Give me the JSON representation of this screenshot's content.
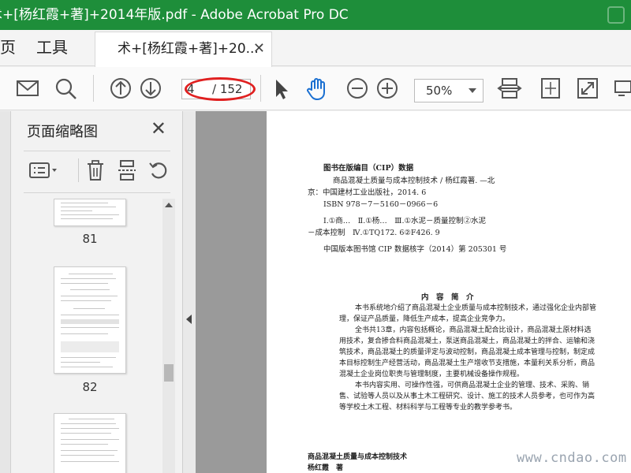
{
  "window": {
    "title": "术+[杨红霞+著]+2014年版.pdf - Adobe Acrobat Pro DC"
  },
  "tabs": {
    "home_partial": "页",
    "tools": "工具",
    "document_tab": "术+[杨红霞+著]+20...",
    "close_glyph": "✕"
  },
  "toolbar": {
    "current_page": "4",
    "total_pages": "/ 152",
    "zoom": "50%"
  },
  "panel": {
    "title": "页面缩略图",
    "close_glyph": "✕",
    "thumbnails": [
      {
        "page": "81"
      },
      {
        "page": "82"
      }
    ]
  },
  "document": {
    "cip_title": "图书在版编目（CIP）数据",
    "cip_line1": "商品混凝土质量与成本控制技术 / 杨红霞著. —北",
    "cip_line2": "京：中国建材工业出版社，2014. 6",
    "cip_line3": "ISBN 978－7－5160－0966－6",
    "cip_line4": "Ⅰ.①商…　Ⅱ.①杨…　Ⅲ.①水泥－质量控制②水泥",
    "cip_line5": "－成本控制　Ⅳ.①TQ172. 6②F426. 9",
    "cip_line6": "中国版本图书馆 CIP 数据核字（2014）第 205301 号",
    "summary_heading": "内　容　简　介",
    "summary_p1_l1": "本书系统地介绍了商品混凝土企业质量与成本控制技术，通过强化企业内部管",
    "summary_p1_l2": "理，保证产品质量，降低生产成本，提高企业竞争力。",
    "summary_p2_l1": "全书共13章，内容包括概论，商品混凝土配合比设计，商品混凝土原材料选",
    "summary_p2_l2": "用技术，复合掺合料商品混凝土，泵送商品混凝土，商品混凝土的拌合、运输和浇",
    "summary_p2_l3": "筑技术，商品混凝土的质量评定与波动控制，商品混凝土成本管理与控制，制定成",
    "summary_p2_l4": "本目标控制生产经营活动，商品混凝土生产增收节支措施，本量利关系分析，商品",
    "summary_p2_l5": "混凝土企业岗位职责与管理制度，主要机械设备操作规程。",
    "summary_p3_l1": "本书内容实用、可操作性强，可供商品混凝土企业的管理、技术、采购、销",
    "summary_p3_l2": "售、试验等人员以及从事土木工程研究、设计、施工的技术人员参考，也可作为高",
    "summary_p3_l3": "等学校土木工程、材料科学与工程等专业的教学参考书。",
    "book_title": "商品混凝土质量与成本控制技术",
    "author": "杨红霞　著"
  },
  "watermark": "www.cndao.com",
  "colors": {
    "titlebar": "#1e8e3a",
    "hand_tool": "#1a6fd1",
    "annotation": "#e02020"
  }
}
